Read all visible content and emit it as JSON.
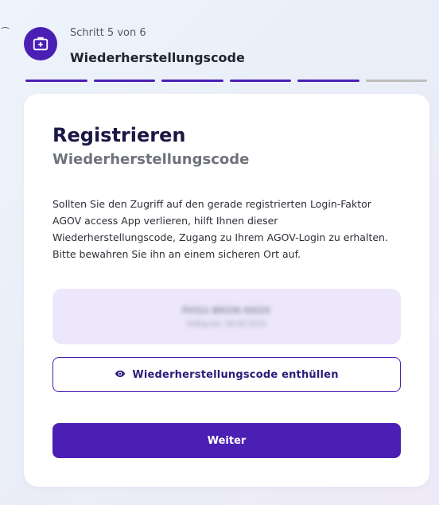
{
  "cursor": "⁀",
  "header": {
    "icon": "first-aid-kit-icon",
    "step_text": "Schritt 5 von 6",
    "step_title": "Wiederherstellungscode",
    "progress": {
      "completed": 5,
      "total": 6
    }
  },
  "card": {
    "title": "Registrieren",
    "subtitle": "Wiederherstellungscode",
    "body": "Sollten Sie den Zugriff auf den gerade registrierten Login-Faktor AGOV access App verlieren, hilft Ihnen dieser Wiederherstellungscode, Zugang zu Ihrem AGOV-Login zu erhalten. Bitte bewahren Sie ihn an einem sicheren Ort auf.",
    "code_main": "PHSU-BKON-KKOX",
    "code_sub": "Gültig bis: 00.00.2031",
    "reveal_button": "Wiederherstellungscode enthüllen",
    "next_button": "Weiter"
  },
  "colors": {
    "accent": "#4b1fb3",
    "code_box_bg": "#ece7fb",
    "progress_inactive": "#bdbdbd"
  }
}
